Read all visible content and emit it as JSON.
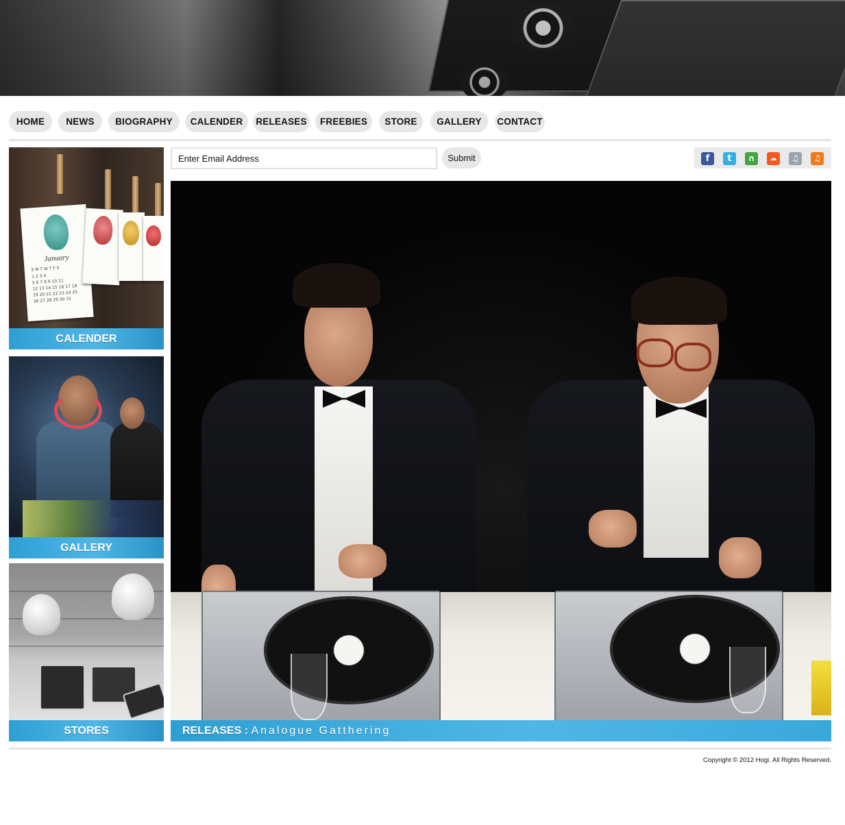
{
  "nav": {
    "items": [
      "HOME",
      "NEWS",
      "BIOGRAPHY",
      "CALENDER",
      "RELEASES",
      "FREEBIES",
      "STORE",
      "GALLERY",
      "CONTACT"
    ]
  },
  "panels": {
    "calender": "CALENDER",
    "gallery": "GALLERY",
    "stores": "STORES"
  },
  "calendar_card": {
    "month": "January",
    "days_header": "S M T W T F S",
    "rows": [
      "1 2 3 4",
      "5 6 7 8 9 10 11",
      "12 13 14 15 16 17 18",
      "19 20 21 22 23 24 25",
      "26 27 28 29 30 31"
    ]
  },
  "newsletter": {
    "placeholder": "Enter Email Address",
    "submit_label": "Submit"
  },
  "social": {
    "icons": [
      "facebook-icon",
      "twitter-icon",
      "headphones-icon",
      "soundcloud-icon",
      "music-note-icon",
      "itunes-icon"
    ],
    "colors": [
      "#3b5998",
      "#33aee3",
      "#44a342",
      "#f15a22",
      "#9aa5ad",
      "#f07a18"
    ]
  },
  "hero": {
    "label": "RELEASES :",
    "title": "Analogue Gatthering"
  },
  "footer": {
    "copyright": "Copyright © 2012 Hogi. All Rights Reserved."
  },
  "colors": {
    "accent_bar": "#3aa9dd",
    "nav_button": "#e7e7e7"
  }
}
